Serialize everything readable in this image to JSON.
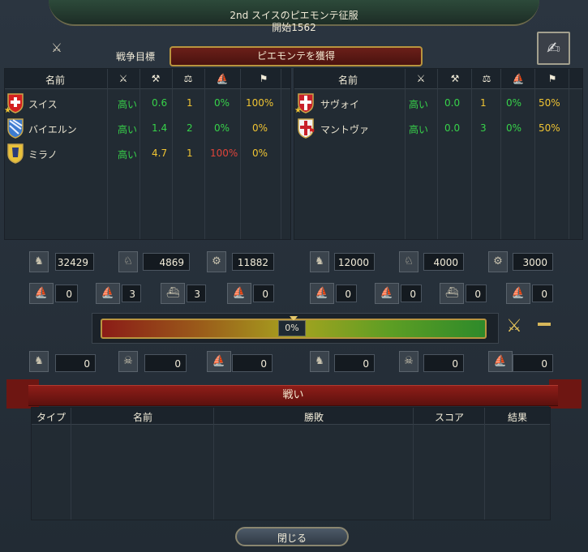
{
  "header": {
    "title": "2nd スイスのピエモンテ征服",
    "subtitle": "開始1562",
    "goal_label": "戦争目標",
    "goal_value": "ピエモンテを獲得"
  },
  "left_table": {
    "columns": [
      "名前",
      "swords-icon",
      "axes-icon",
      "scale-icon",
      "ships-icon",
      "soldier-icon"
    ],
    "rows": [
      {
        "name": "スイス",
        "c1": "高い",
        "c2": "0.6",
        "c3": "1",
        "c4": "0%",
        "c5": "100%"
      },
      {
        "name": "バイエルン",
        "c1": "高い",
        "c2": "1.4",
        "c3": "2",
        "c4": "0%",
        "c5": "0%"
      },
      {
        "name": "ミラノ",
        "c1": "高い",
        "c2": "4.7",
        "c3": "1",
        "c4": "100%",
        "c5": "0%"
      }
    ]
  },
  "right_table": {
    "columns": [
      "名前",
      "swords-icon",
      "axes-icon",
      "scale-icon",
      "ships-icon",
      "soldier-icon"
    ],
    "rows": [
      {
        "name": "サヴォイ",
        "c1": "高い",
        "c2": "0.0",
        "c3": "1",
        "c4": "0%",
        "c5": "50%"
      },
      {
        "name": "マントヴァ",
        "c1": "高い",
        "c2": "0.0",
        "c3": "3",
        "c4": "0%",
        "c5": "50%"
      }
    ]
  },
  "left_forces": {
    "infantry": "32429",
    "cavalry": "4869",
    "artillery": "11882",
    "heavy_ships": "0",
    "light_ships": "3",
    "galleys": "3",
    "transports": "0",
    "losses_infantry": "0",
    "losses_cavalry": "0",
    "losses_ships": "0"
  },
  "right_forces": {
    "infantry": "12000",
    "cavalry": "4000",
    "artillery": "3000",
    "heavy_ships": "0",
    "light_ships": "0",
    "galleys": "0",
    "transports": "0",
    "losses_infantry": "0",
    "losses_cavalry": "0",
    "losses_ships": "0"
  },
  "warscore": {
    "value": "0%",
    "progress": 0.5
  },
  "battles": {
    "title": "戦い",
    "columns": [
      "タイプ",
      "名前",
      "勝敗",
      "スコア",
      "結果"
    ]
  },
  "close_label": "閉じる",
  "colors": {
    "accent": "#b9953f",
    "banner": "#8e1d18",
    "good": "#37d24a",
    "warn": "#f0c433",
    "bad": "#e0443a"
  }
}
